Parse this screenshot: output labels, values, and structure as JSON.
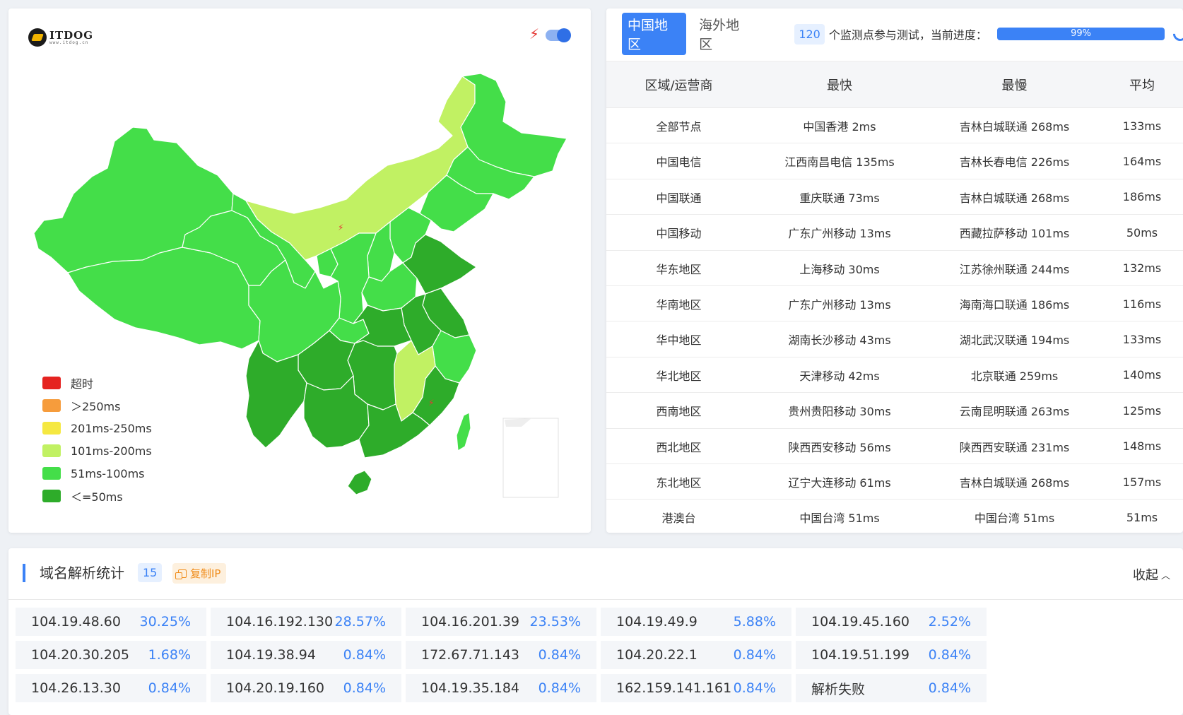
{
  "logo": {
    "text": "ITDOG",
    "sub": "www.itdog.cn"
  },
  "legend": [
    {
      "label": "超时",
      "color": "#e52320"
    },
    {
      "label": "＞250ms",
      "color": "#f69c3c"
    },
    {
      "label": "201ms-250ms",
      "color": "#f5e841"
    },
    {
      "label": "101ms-200ms",
      "color": "#c1f163"
    },
    {
      "label": "51ms-100ms",
      "color": "#44de49"
    },
    {
      "label": "＜=50ms",
      "color": "#2eac2a"
    }
  ],
  "tabs": {
    "active": "中国地区",
    "inactive": "海外地区"
  },
  "monitor": {
    "count": "120",
    "text": "个监测点参与测试，当前进度：",
    "progress_label": "99%",
    "progress": 0.99
  },
  "table": {
    "headers": [
      "区域/运营商",
      "最快",
      "最慢",
      "平均"
    ],
    "rows": [
      [
        "全部节点",
        "中国香港 2ms",
        "吉林白城联通 268ms",
        "133ms"
      ],
      [
        "中国电信",
        "江西南昌电信 135ms",
        "吉林长春电信 226ms",
        "164ms"
      ],
      [
        "中国联通",
        "重庆联通 73ms",
        "吉林白城联通 268ms",
        "186ms"
      ],
      [
        "中国移动",
        "广东广州移动 13ms",
        "西藏拉萨移动 101ms",
        "50ms"
      ],
      [
        "华东地区",
        "上海移动 30ms",
        "江苏徐州联通 244ms",
        "132ms"
      ],
      [
        "华南地区",
        "广东广州移动 13ms",
        "海南海口联通 186ms",
        "116ms"
      ],
      [
        "华中地区",
        "湖南长沙移动 43ms",
        "湖北武汉联通 194ms",
        "133ms"
      ],
      [
        "华北地区",
        "天津移动 42ms",
        "北京联通 259ms",
        "140ms"
      ],
      [
        "西南地区",
        "贵州贵阳移动 30ms",
        "云南昆明联通 263ms",
        "125ms"
      ],
      [
        "西北地区",
        "陕西西安移动 56ms",
        "陕西西安联通 231ms",
        "148ms"
      ],
      [
        "东北地区",
        "辽宁大连移动 61ms",
        "吉林白城联通 268ms",
        "157ms"
      ],
      [
        "港澳台",
        "中国台湾 51ms",
        "中国台湾 51ms",
        "51ms"
      ]
    ]
  },
  "dns": {
    "title": "域名解析统计",
    "count": "15",
    "copy_label": "复制IP",
    "collapse_label": "收起",
    "entries": [
      [
        "104.19.48.60",
        "30.25%"
      ],
      [
        "104.16.192.130",
        "28.57%"
      ],
      [
        "104.16.201.39",
        "23.53%"
      ],
      [
        "104.19.49.9",
        "5.88%"
      ],
      [
        "104.19.45.160",
        "2.52%"
      ],
      [
        "104.20.30.205",
        "1.68%"
      ],
      [
        "104.19.38.94",
        "0.84%"
      ],
      [
        "172.67.71.143",
        "0.84%"
      ],
      [
        "104.20.22.1",
        "0.84%"
      ],
      [
        "104.19.51.199",
        "0.84%"
      ],
      [
        "104.26.13.30",
        "0.84%"
      ],
      [
        "104.20.19.160",
        "0.84%"
      ],
      [
        "104.19.35.184",
        "0.84%"
      ],
      [
        "162.159.141.161",
        "0.84%"
      ],
      [
        "解析失败",
        "0.84%"
      ]
    ]
  }
}
